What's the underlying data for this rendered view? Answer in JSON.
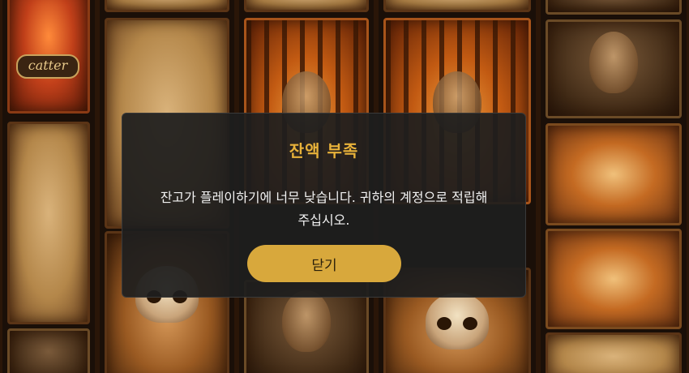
{
  "background": {
    "scatter_label": "catter",
    "symbols": [
      "brain-jar-icon",
      "caged-prisoner-icon",
      "tortured-face-icon",
      "skull-icon",
      "fetus-skeleton-icon",
      "foot-bones-icon"
    ]
  },
  "dialog": {
    "title": "잔액 부족",
    "message_line1": "잔고가 플레이하기에 너무 낮습니다. 귀하의 계정으로 적립해",
    "message_line2": "주십시오.",
    "close_label": "닫기"
  },
  "colors": {
    "title": "#e8b23a",
    "button": "#d8a83c",
    "dialog_bg": "#1e1e1e"
  }
}
